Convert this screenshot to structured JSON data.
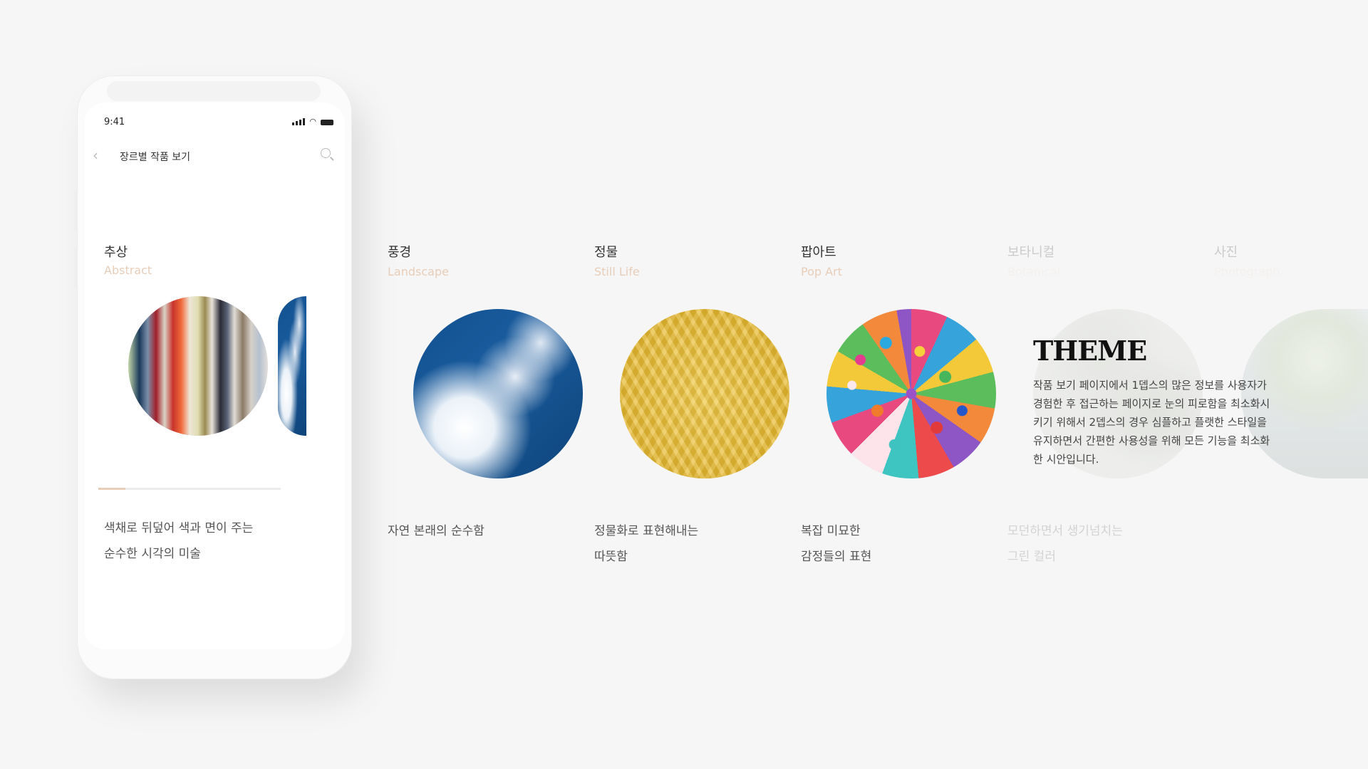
{
  "phone": {
    "status": {
      "time": "9:41"
    },
    "header": {
      "title": "장르별 작품 보기"
    },
    "genre": {
      "title": "추상",
      "subtitle": "Abstract",
      "desc_line1": "색채로 뒤덮어 색과 면이 주는",
      "desc_line2": "순수한 시각의 미술",
      "progress_fraction": 0.15
    }
  },
  "genres": [
    {
      "title": "풍경",
      "subtitle": "Landscape",
      "desc_line1": "자연 본래의 순수함",
      "desc_line2": ""
    },
    {
      "title": "정물",
      "subtitle": "Still Life",
      "desc_line1": "정물화로 표현해내는",
      "desc_line2": "따뜻함"
    },
    {
      "title": "팝아트",
      "subtitle": "Pop Art",
      "desc_line1": "복잡 미묘한",
      "desc_line2": "감정들의 표현"
    },
    {
      "title": "보타니컬",
      "subtitle": "Botanical",
      "desc_line1": "모던하면서 생기넘치는",
      "desc_line2": "그린 컬러"
    },
    {
      "title": "사진",
      "subtitle": "Photograph",
      "desc_line1": "",
      "desc_line2": ""
    }
  ],
  "theme": {
    "title": "THEME",
    "text": "작품 보기 페이지에서 1뎁스의 많은 정보를 사용자가 경험한 후 접근하는 페이지로 눈의 피로함을 최소화시키기 위해서 2뎁스의 경우 심플하고 플랫한 스타일을 유지하면서 간편한 사용성을 위해 모든 기능을 최소화한 시안입니다."
  },
  "colors": {
    "accent": "#e8cdb8",
    "background": "#f6f6f6"
  },
  "icons": [
    "back-icon",
    "search-icon",
    "signal-icon",
    "wifi-icon",
    "battery-icon"
  ]
}
